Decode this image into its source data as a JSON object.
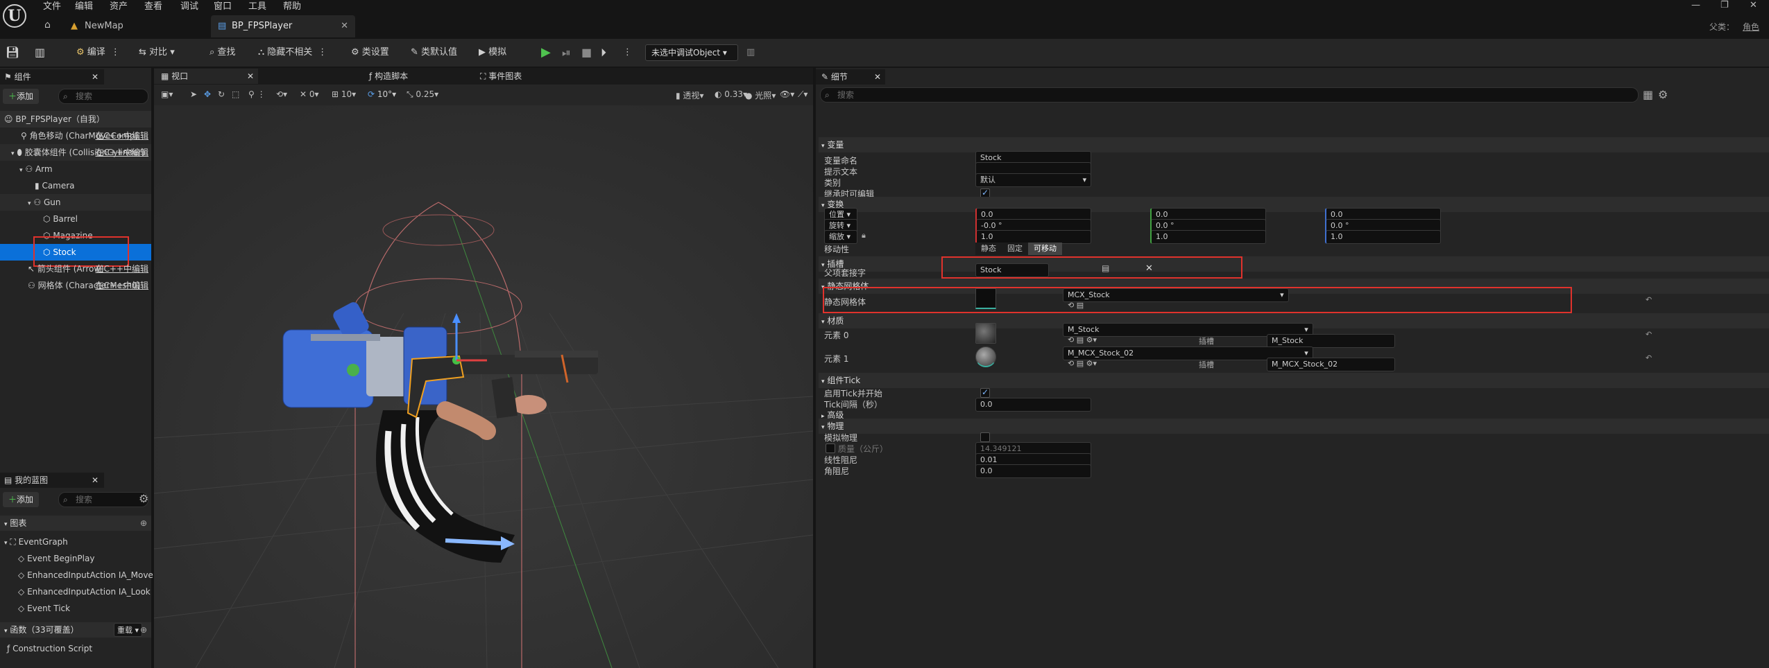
{
  "menubar": {
    "items": [
      "文件",
      "编辑",
      "资产",
      "查看",
      "调试",
      "窗口",
      "工具",
      "帮助"
    ]
  },
  "tabs": [
    {
      "label": "NewMap"
    },
    {
      "label": "BP_FPSPlayer"
    }
  ],
  "parent_label": "父类：",
  "parent_value": "角色",
  "toolbar": {
    "compile": "编译",
    "diff": "对比",
    "find": "查找",
    "hide": "隐藏不相关",
    "class_settings": "类设置",
    "class_defaults": "类默认值",
    "simulate": "模拟",
    "debug_object": "未选中调试Object"
  },
  "components_panel": {
    "title": "组件",
    "add": "添加",
    "search_placeholder": "搜索",
    "items": [
      {
        "label": "BP_FPSPlayer（自我）"
      },
      {
        "label": "角色移动 (CharMoveComp)",
        "link": "在C++中编辑"
      },
      {
        "label": "胶囊体组件 (CollisionCylinder)",
        "link": "在C++中编辑"
      },
      {
        "label": "Arm"
      },
      {
        "label": "Camera"
      },
      {
        "label": "Gun"
      },
      {
        "label": "Barrel"
      },
      {
        "label": "Magazine"
      },
      {
        "label": "Stock"
      },
      {
        "label": "箭头组件 (Arrow)",
        "link": "在C++中编辑"
      },
      {
        "label": "网格体 (CharacterMesh0)",
        "link": "在C++中编辑"
      }
    ]
  },
  "blueprint_panel": {
    "title": "我的蓝图",
    "add": "添加",
    "search_placeholder": "搜索",
    "graphs_label": "图表",
    "event_graph": "EventGraph",
    "events": [
      "Event BeginPlay",
      "EnhancedInputAction IA_Move",
      "EnhancedInputAction IA_Look",
      "Event Tick"
    ],
    "functions_label": "函数（33可覆盖）",
    "override_label": "重载",
    "construction": "Construction Script"
  },
  "viewport": {
    "tabs": [
      "视口",
      "构造脚本",
      "事件图表"
    ],
    "snap_values": [
      "0",
      "10",
      "10°",
      "0.25"
    ],
    "perspective": "透视",
    "speed": "0.33",
    "lit": "光照"
  },
  "details": {
    "title": "细节",
    "search_placeholder": "搜索",
    "sections": {
      "variable": "变量",
      "transform": "变换",
      "socket": "插槽",
      "static_mesh": "静态网格体",
      "materials": "材质",
      "tick": "组件Tick",
      "advanced": "高级",
      "physics": "物理"
    },
    "var_name_label": "变量命名",
    "var_name": "Stock",
    "tooltip_label": "提示文本",
    "category_label": "类别",
    "category_value": "默认",
    "editable_label": "继承时可编辑",
    "location_label": "位置",
    "location": [
      "0.0",
      "0.0",
      "0.0"
    ],
    "rotation_label": "旋转",
    "rotation": [
      "-0.0 °",
      "0.0 °",
      "0.0 °"
    ],
    "scale_label": "缩放",
    "scale": [
      "1.0",
      "1.0",
      "1.0"
    ],
    "mobility_label": "移动性",
    "mobility_options": [
      "静态",
      "固定",
      "可移动"
    ],
    "parent_socket_label": "父项套接字",
    "parent_socket": "Stock",
    "static_mesh_label": "静态网格体",
    "static_mesh": "MCX_Stock",
    "element0_label": "元素 0",
    "element0": "M_Stock",
    "element0_slot": "M_Stock",
    "element1_label": "元素 1",
    "element1": "M_MCX_Stock_02",
    "element1_slot": "M_MCX_Stock_02",
    "slot_label": "插槽",
    "tick_start_label": "启用Tick并开始",
    "tick_interval_label": "Tick间隔（秒）",
    "tick_interval": "0.0",
    "simulate_label": "模拟物理",
    "mass_label": "质量（公斤）",
    "mass": "14.349121",
    "linear_damping_label": "线性阻尼",
    "linear_damping": "0.01",
    "angular_damping_label": "角阻尼",
    "angular_damping": "0.0"
  },
  "colors": {
    "accent": "#0a70d9",
    "highlight": "#e0322c",
    "panel": "#242424",
    "background": "#151515"
  }
}
